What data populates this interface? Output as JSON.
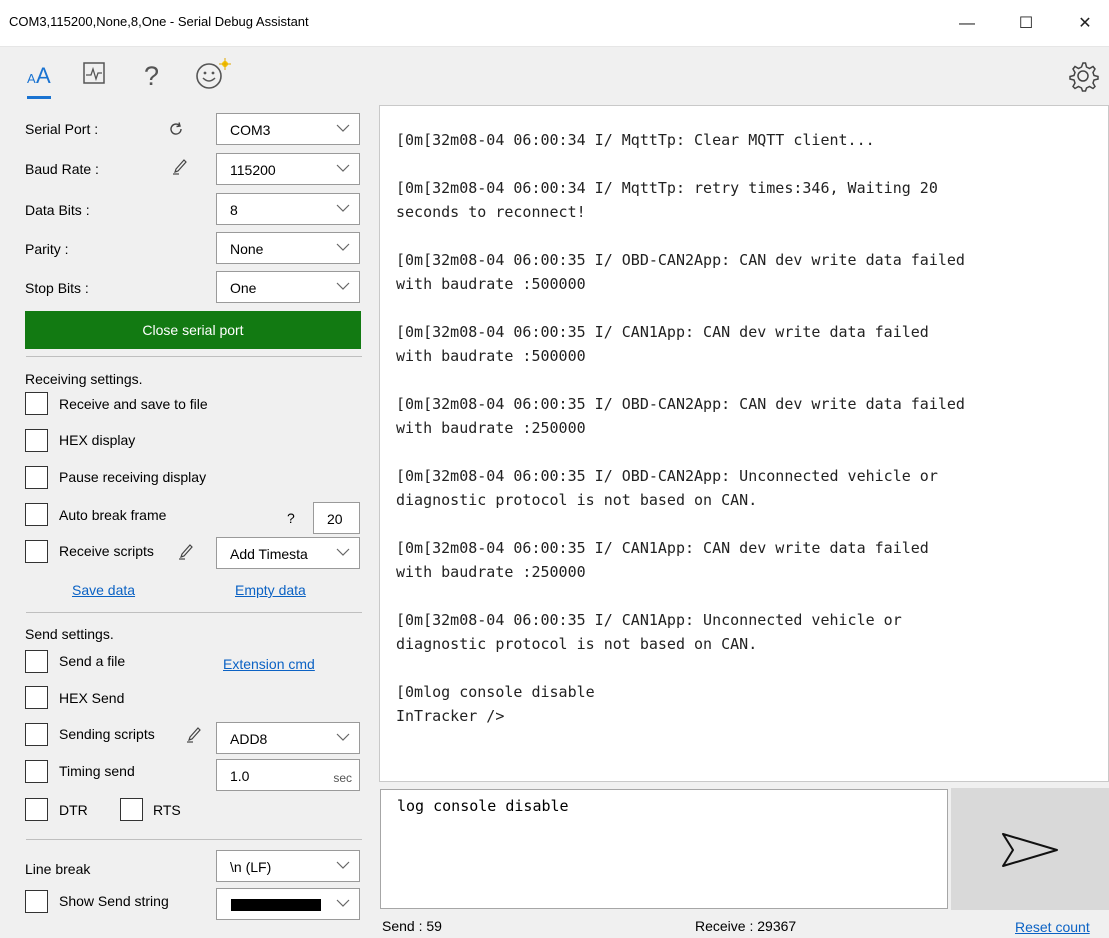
{
  "window": {
    "title": "COM3,115200,None,8,One - Serial Debug Assistant",
    "minimize": "—",
    "maximize": "☐",
    "close": "✕"
  },
  "toolbar": {
    "icons": [
      "font-size-icon",
      "chart-icon",
      "help-icon",
      "smiley-icon"
    ],
    "font_label": "ᴀA",
    "help_label": "?",
    "accent": "#1a73d1",
    "settings_icon": "gear-icon"
  },
  "serial": {
    "port_label": "Serial Port :",
    "port_value": "COM3",
    "baud_label": "Baud Rate :",
    "baud_value": "115200",
    "databits_label": "Data Bits :",
    "databits_value": "8",
    "parity_label": "Parity :",
    "parity_value": "None",
    "stopbits_label": "Stop Bits :",
    "stopbits_value": "One",
    "close_button": "Close serial port",
    "close_button_color": "#127a12"
  },
  "receiving": {
    "heading": "Receiving settings.",
    "save_to_file": "Receive and save to file",
    "hex_display": "HEX display",
    "pause_display": "Pause receiving display",
    "auto_break": "Auto break frame",
    "auto_break_help": "?",
    "auto_break_value": "20",
    "receive_scripts": "Receive scripts",
    "receive_scripts_value": "Add Timesta",
    "save_data": "Save data",
    "empty_data": "Empty data"
  },
  "sending": {
    "heading": "Send settings.",
    "send_file": "Send a file",
    "extension_cmd": "Extension cmd",
    "hex_send": "HEX Send",
    "sending_scripts": "Sending scripts",
    "sending_scripts_value": "ADD8",
    "timing_send": "Timing send",
    "timing_value": "1.0",
    "timing_unit": "sec",
    "dtr": "DTR",
    "rts": "RTS",
    "line_break_label": "Line break",
    "line_break_value": "\\n (LF)",
    "show_send_string": "Show Send string",
    "send_string_color": "#000000"
  },
  "receive_text": "[0m[32m08-04 06:00:34 I/ MqttTp: Clear MQTT client...\n\n[0m[32m08-04 06:00:34 I/ MqttTp: retry times:346, Waiting 20\nseconds to reconnect!\n\n[0m[32m08-04 06:00:35 I/ OBD-CAN2App: CAN dev write data failed\nwith baudrate :500000\n\n[0m[32m08-04 06:00:35 I/ CAN1App: CAN dev write data failed\nwith baudrate :500000\n\n[0m[32m08-04 06:00:35 I/ OBD-CAN2App: CAN dev write data failed\nwith baudrate :250000\n\n[0m[32m08-04 06:00:35 I/ OBD-CAN2App: Unconnected vehicle or\ndiagnostic protocol is not based on CAN.\n\n[0m[32m08-04 06:00:35 I/ CAN1App: CAN dev write data failed\nwith baudrate :250000\n\n[0m[32m08-04 06:00:35 I/ CAN1App: Unconnected vehicle or\ndiagnostic protocol is not based on CAN.\n\n[0mlog console disable\nInTracker />",
  "send_input": "log console disable",
  "status": {
    "send": "Send : 59",
    "receive": "Receive : 29367",
    "reset": "Reset count"
  }
}
